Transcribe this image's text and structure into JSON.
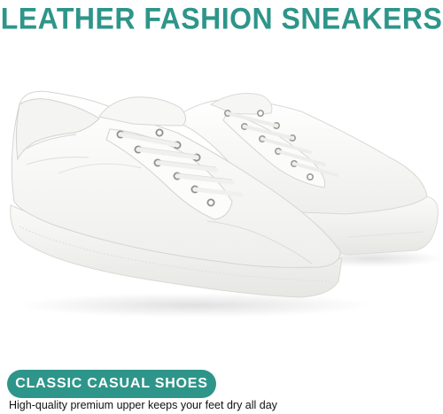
{
  "headline": "LEATHER FASHION SNEAKERS",
  "badge": {
    "label": "CLASSIC CASUAL SHOES"
  },
  "description": "High-quality premium upper keeps your feet dry all day",
  "colors": {
    "accent": "#2e958a",
    "background": "#ffffff",
    "text": "#111111"
  },
  "image": {
    "subject": "pair of white leather lace-up sneakers"
  }
}
